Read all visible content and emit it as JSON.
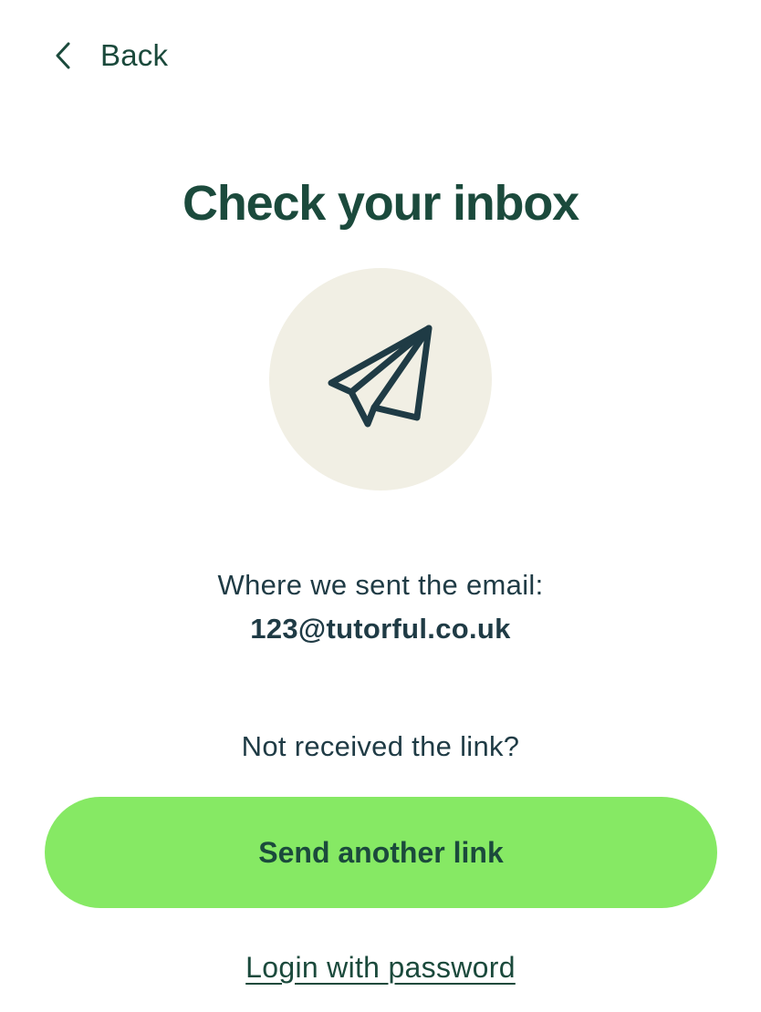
{
  "header": {
    "back_label": "Back",
    "back_icon": "chevron-left-icon"
  },
  "main": {
    "title": "Check your inbox",
    "hero_icon": "paper-plane-icon",
    "sent_label": "Where we sent the email:",
    "email": "123@tutorful.co.uk",
    "not_received": "Not received the link?",
    "resend_button_label": "Send another link",
    "login_link_label": "Login with password"
  },
  "colors": {
    "primary_text": "#1b4a3c",
    "body_text": "#1f3b45",
    "button_bg": "#86e964",
    "hero_circle_bg": "#f1efe4",
    "icon_stroke": "#1f3b45"
  }
}
